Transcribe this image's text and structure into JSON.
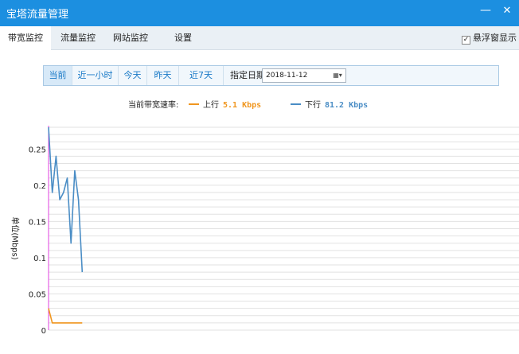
{
  "window": {
    "title": "宝塔流量管理",
    "minimize_glyph": "—",
    "close_glyph": "✕"
  },
  "tabs": [
    {
      "label": "带宽监控",
      "active": true
    },
    {
      "label": "流量监控",
      "active": false
    },
    {
      "label": "网站监控",
      "active": false
    },
    {
      "label": "设置",
      "active": false
    }
  ],
  "float_window": {
    "label": "悬浮窗显示",
    "checked": true,
    "check_glyph": "✓"
  },
  "filters": [
    {
      "label": "当前",
      "active": true
    },
    {
      "label": "近一小时",
      "active": false
    },
    {
      "label": "今天",
      "active": false
    },
    {
      "label": "昨天",
      "active": false
    },
    {
      "label": "近7天",
      "active": false
    }
  ],
  "date_filter": {
    "label": "指定日期",
    "value": "2018-11-12",
    "picker_glyph": "▦▾"
  },
  "legend": {
    "caption": "当前带宽速率:",
    "upload": {
      "label": "上行",
      "value": "5.1 Kbps",
      "color": "#f0961f"
    },
    "download": {
      "label": "下行",
      "value": "81.2 Kbps",
      "color": "#4a8dc5"
    }
  },
  "colors": {
    "titlebar": "#1c8fe0",
    "grid": "#e2e2e2",
    "axis": "#e040e0"
  },
  "chart_data": {
    "type": "line",
    "ylabel": "单位(Mbps)",
    "ylim": [
      0,
      0.28
    ],
    "yticks": [
      0,
      0.05,
      0.1,
      0.15,
      0.2,
      0.25
    ],
    "ytick_labels": [
      "0",
      "0.05",
      "0.1",
      "0.15",
      "0.2",
      "0.25"
    ],
    "grid": true,
    "series": [
      {
        "name": "下行",
        "color": "#4a8dc5",
        "values": [
          0.28,
          0.19,
          0.24,
          0.18,
          0.19,
          0.21,
          0.12,
          0.22,
          0.18,
          0.08
        ]
      },
      {
        "name": "上行",
        "color": "#f0961f",
        "values": [
          0.03,
          0.01,
          0.01,
          0.01,
          0.01,
          0.01,
          0.01,
          0.01,
          0.01,
          0.01
        ]
      }
    ]
  }
}
